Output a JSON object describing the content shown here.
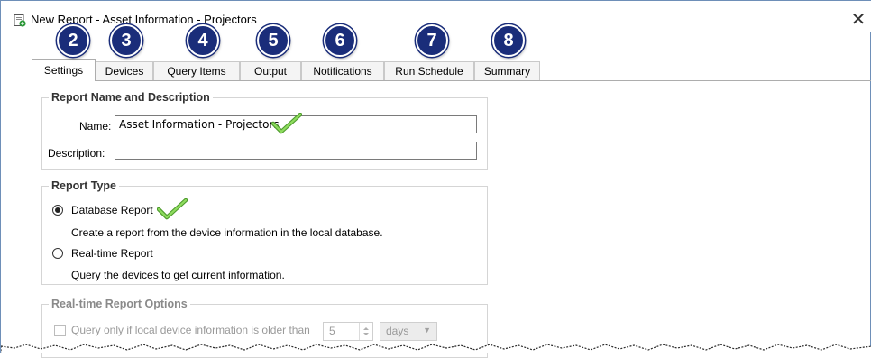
{
  "window": {
    "title": "New Report - Asset Information - Projectors",
    "close_glyph": "✕"
  },
  "badges": [
    "2",
    "3",
    "4",
    "5",
    "6",
    "7",
    "8"
  ],
  "tabs": [
    {
      "label": "Settings",
      "active": true
    },
    {
      "label": "Devices"
    },
    {
      "label": "Query Items"
    },
    {
      "label": "Output"
    },
    {
      "label": "Notifications"
    },
    {
      "label": "Run Schedule"
    },
    {
      "label": "Summary"
    }
  ],
  "report_name_group": {
    "legend": "Report Name and Description",
    "name_label": "Name:",
    "name_value": "Asset Information - Projectors",
    "description_label": "Description:",
    "description_value": ""
  },
  "report_type_group": {
    "legend": "Report Type",
    "database_label": "Database Report",
    "database_desc": "Create a report from the device information in the local database.",
    "database_selected": true,
    "realtime_label": "Real-time Report",
    "realtime_desc": "Query the devices to get current information.",
    "realtime_selected": false
  },
  "realtime_options_group": {
    "legend": "Real-time Report Options",
    "query_label": "Query only if local device information is older than",
    "query_checked": false,
    "age_value": "5",
    "age_unit": "days"
  },
  "colors": {
    "badge_fill": "#1a2d7a",
    "checkmark": "#6cc04a",
    "window_border": "#6e8fb8"
  },
  "icons": {
    "app": "report-app-icon",
    "close": "close-icon",
    "checkmark": "checkmark-annotation-icon"
  }
}
